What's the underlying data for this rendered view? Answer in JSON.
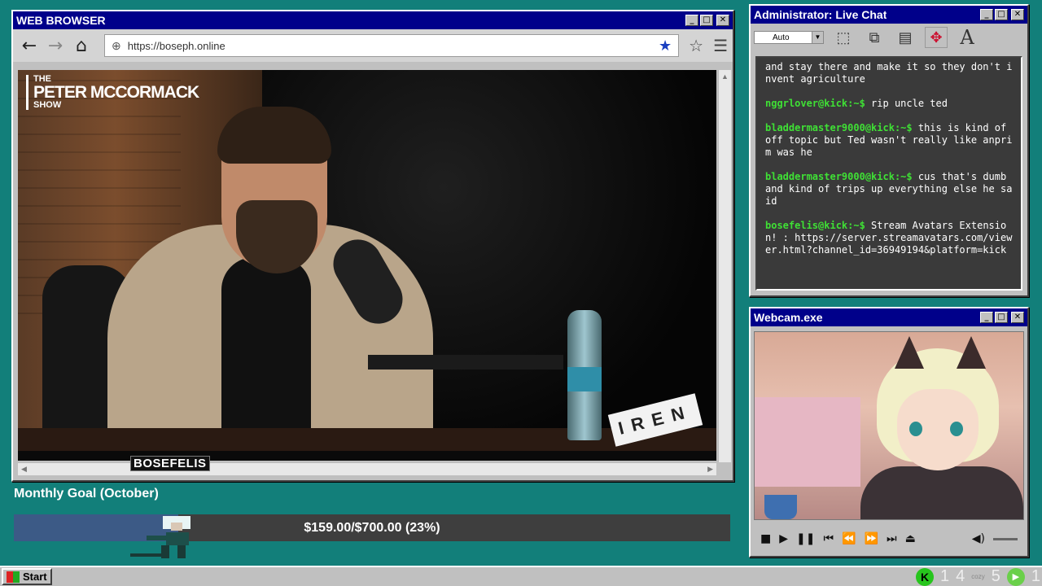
{
  "browser": {
    "title": "WEB BROWSER",
    "url": "https://boseph.online",
    "video": {
      "show_logo": [
        "THE",
        "PETER MCCORMACK",
        "SHOW"
      ],
      "sponsor": "IREN"
    }
  },
  "streamer_tag": "BOSEFELIS",
  "chat": {
    "title": "Administrator: Live Chat",
    "zoom_select": "Auto",
    "messages": [
      {
        "user": "",
        "text": "and stay there and make it so they don't invent agriculture"
      },
      {
        "user": "nggrlover@kick:~$",
        "text": " rip uncle ted"
      },
      {
        "user": "bladdermaster9000@kick:~$",
        "text": " this is kind of off topic but Ted wasn't really like anprim was he"
      },
      {
        "user": "bladdermaster9000@kick:~$",
        "text": " cus that's dumb and kind of trips up everything else he said"
      },
      {
        "user": "bosefelis@kick:~$",
        "text": " Stream Avatars Extension! : https://server.streamavatars.com/viewer.html?channel_id=36949194&platform=kick"
      }
    ]
  },
  "webcam": {
    "title": "Webcam.exe"
  },
  "goal": {
    "title": "Monthly Goal (October)",
    "text": "$159.00/$700.00 (23%)",
    "fraction": 0.23
  },
  "taskbar": {
    "start": "Start",
    "tray": [
      "1",
      "4",
      "cozy",
      "5",
      "1"
    ]
  }
}
